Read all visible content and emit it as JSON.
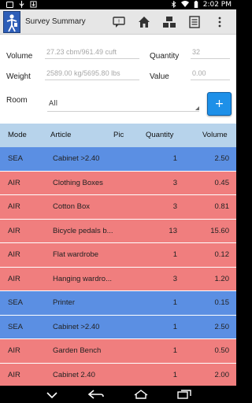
{
  "status_bar": {
    "time": "2:02 PM"
  },
  "app": {
    "title": "Survey Summary"
  },
  "form": {
    "volume_label": "Volume",
    "volume_value": "27.23 cbm/961.49 cuft",
    "quantity_label": "Quantity",
    "quantity_value": "32",
    "weight_label": "Weight",
    "weight_value": "2589.00 kg/5695.80 lbs",
    "value_label": "Value",
    "value_value": "0.00",
    "room_label": "Room",
    "room_value": "All",
    "add_label": "+"
  },
  "table": {
    "headers": {
      "mode": "Mode",
      "article": "Article",
      "pic": "Pic",
      "quantity": "Quantity",
      "volume": "Volume"
    },
    "rows": [
      {
        "mode": "SEA",
        "article": "Cabinet >2.40",
        "quantity": "1",
        "volume": "2.50"
      },
      {
        "mode": "AIR",
        "article": "Clothing Boxes",
        "quantity": "3",
        "volume": "0.45"
      },
      {
        "mode": "AIR",
        "article": "Cotton Box",
        "quantity": "3",
        "volume": "0.81"
      },
      {
        "mode": "AIR",
        "article": "Bicycle pedals b...",
        "quantity": "13",
        "volume": "15.60"
      },
      {
        "mode": "AIR",
        "article": "Flat wardrobe",
        "quantity": "1",
        "volume": "0.12"
      },
      {
        "mode": "AIR",
        "article": "Hanging wardro...",
        "quantity": "3",
        "volume": "1.20"
      },
      {
        "mode": "SEA",
        "article": "Printer",
        "quantity": "1",
        "volume": "0.15"
      },
      {
        "mode": "SEA",
        "article": "Cabinet >2.40",
        "quantity": "1",
        "volume": "2.50"
      },
      {
        "mode": "AIR",
        "article": "Garden Bench",
        "quantity": "1",
        "volume": "0.50"
      },
      {
        "mode": "AIR",
        "article": "Cabinet 2.40",
        "quantity": "1",
        "volume": "2.00"
      }
    ]
  },
  "colors": {
    "sea": "#5b8fe3",
    "air": "#f07e7e",
    "header": "#b7d3eb",
    "add_button": "#1e90e8"
  }
}
